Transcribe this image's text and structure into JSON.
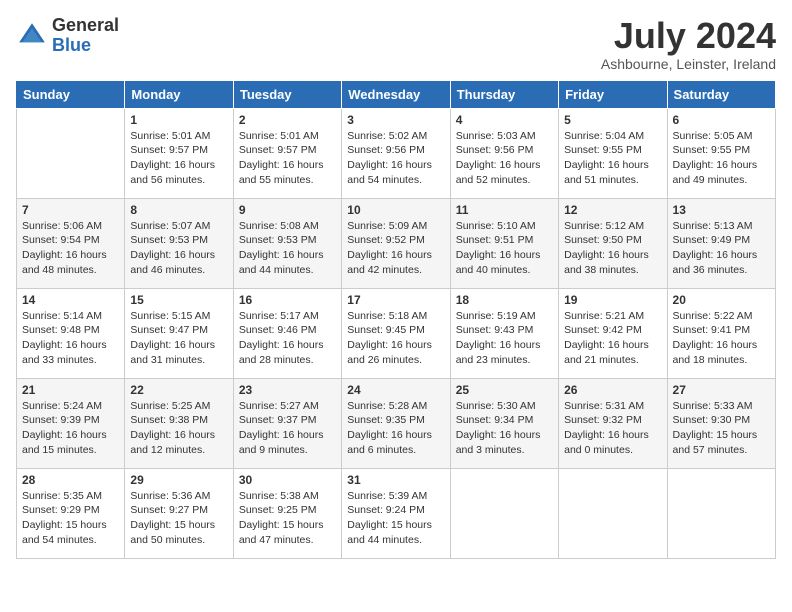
{
  "header": {
    "logo_general": "General",
    "logo_blue": "Blue",
    "month_year": "July 2024",
    "location": "Ashbourne, Leinster, Ireland"
  },
  "calendar": {
    "days_of_week": [
      "Sunday",
      "Monday",
      "Tuesday",
      "Wednesday",
      "Thursday",
      "Friday",
      "Saturday"
    ],
    "weeks": [
      [
        {
          "day": "",
          "sunrise": "",
          "sunset": "",
          "daylight": ""
        },
        {
          "day": "1",
          "sunrise": "Sunrise: 5:01 AM",
          "sunset": "Sunset: 9:57 PM",
          "daylight": "Daylight: 16 hours and 56 minutes."
        },
        {
          "day": "2",
          "sunrise": "Sunrise: 5:01 AM",
          "sunset": "Sunset: 9:57 PM",
          "daylight": "Daylight: 16 hours and 55 minutes."
        },
        {
          "day": "3",
          "sunrise": "Sunrise: 5:02 AM",
          "sunset": "Sunset: 9:56 PM",
          "daylight": "Daylight: 16 hours and 54 minutes."
        },
        {
          "day": "4",
          "sunrise": "Sunrise: 5:03 AM",
          "sunset": "Sunset: 9:56 PM",
          "daylight": "Daylight: 16 hours and 52 minutes."
        },
        {
          "day": "5",
          "sunrise": "Sunrise: 5:04 AM",
          "sunset": "Sunset: 9:55 PM",
          "daylight": "Daylight: 16 hours and 51 minutes."
        },
        {
          "day": "6",
          "sunrise": "Sunrise: 5:05 AM",
          "sunset": "Sunset: 9:55 PM",
          "daylight": "Daylight: 16 hours and 49 minutes."
        }
      ],
      [
        {
          "day": "7",
          "sunrise": "Sunrise: 5:06 AM",
          "sunset": "Sunset: 9:54 PM",
          "daylight": "Daylight: 16 hours and 48 minutes."
        },
        {
          "day": "8",
          "sunrise": "Sunrise: 5:07 AM",
          "sunset": "Sunset: 9:53 PM",
          "daylight": "Daylight: 16 hours and 46 minutes."
        },
        {
          "day": "9",
          "sunrise": "Sunrise: 5:08 AM",
          "sunset": "Sunset: 9:53 PM",
          "daylight": "Daylight: 16 hours and 44 minutes."
        },
        {
          "day": "10",
          "sunrise": "Sunrise: 5:09 AM",
          "sunset": "Sunset: 9:52 PM",
          "daylight": "Daylight: 16 hours and 42 minutes."
        },
        {
          "day": "11",
          "sunrise": "Sunrise: 5:10 AM",
          "sunset": "Sunset: 9:51 PM",
          "daylight": "Daylight: 16 hours and 40 minutes."
        },
        {
          "day": "12",
          "sunrise": "Sunrise: 5:12 AM",
          "sunset": "Sunset: 9:50 PM",
          "daylight": "Daylight: 16 hours and 38 minutes."
        },
        {
          "day": "13",
          "sunrise": "Sunrise: 5:13 AM",
          "sunset": "Sunset: 9:49 PM",
          "daylight": "Daylight: 16 hours and 36 minutes."
        }
      ],
      [
        {
          "day": "14",
          "sunrise": "Sunrise: 5:14 AM",
          "sunset": "Sunset: 9:48 PM",
          "daylight": "Daylight: 16 hours and 33 minutes."
        },
        {
          "day": "15",
          "sunrise": "Sunrise: 5:15 AM",
          "sunset": "Sunset: 9:47 PM",
          "daylight": "Daylight: 16 hours and 31 minutes."
        },
        {
          "day": "16",
          "sunrise": "Sunrise: 5:17 AM",
          "sunset": "Sunset: 9:46 PM",
          "daylight": "Daylight: 16 hours and 28 minutes."
        },
        {
          "day": "17",
          "sunrise": "Sunrise: 5:18 AM",
          "sunset": "Sunset: 9:45 PM",
          "daylight": "Daylight: 16 hours and 26 minutes."
        },
        {
          "day": "18",
          "sunrise": "Sunrise: 5:19 AM",
          "sunset": "Sunset: 9:43 PM",
          "daylight": "Daylight: 16 hours and 23 minutes."
        },
        {
          "day": "19",
          "sunrise": "Sunrise: 5:21 AM",
          "sunset": "Sunset: 9:42 PM",
          "daylight": "Daylight: 16 hours and 21 minutes."
        },
        {
          "day": "20",
          "sunrise": "Sunrise: 5:22 AM",
          "sunset": "Sunset: 9:41 PM",
          "daylight": "Daylight: 16 hours and 18 minutes."
        }
      ],
      [
        {
          "day": "21",
          "sunrise": "Sunrise: 5:24 AM",
          "sunset": "Sunset: 9:39 PM",
          "daylight": "Daylight: 16 hours and 15 minutes."
        },
        {
          "day": "22",
          "sunrise": "Sunrise: 5:25 AM",
          "sunset": "Sunset: 9:38 PM",
          "daylight": "Daylight: 16 hours and 12 minutes."
        },
        {
          "day": "23",
          "sunrise": "Sunrise: 5:27 AM",
          "sunset": "Sunset: 9:37 PM",
          "daylight": "Daylight: 16 hours and 9 minutes."
        },
        {
          "day": "24",
          "sunrise": "Sunrise: 5:28 AM",
          "sunset": "Sunset: 9:35 PM",
          "daylight": "Daylight: 16 hours and 6 minutes."
        },
        {
          "day": "25",
          "sunrise": "Sunrise: 5:30 AM",
          "sunset": "Sunset: 9:34 PM",
          "daylight": "Daylight: 16 hours and 3 minutes."
        },
        {
          "day": "26",
          "sunrise": "Sunrise: 5:31 AM",
          "sunset": "Sunset: 9:32 PM",
          "daylight": "Daylight: 16 hours and 0 minutes."
        },
        {
          "day": "27",
          "sunrise": "Sunrise: 5:33 AM",
          "sunset": "Sunset: 9:30 PM",
          "daylight": "Daylight: 15 hours and 57 minutes."
        }
      ],
      [
        {
          "day": "28",
          "sunrise": "Sunrise: 5:35 AM",
          "sunset": "Sunset: 9:29 PM",
          "daylight": "Daylight: 15 hours and 54 minutes."
        },
        {
          "day": "29",
          "sunrise": "Sunrise: 5:36 AM",
          "sunset": "Sunset: 9:27 PM",
          "daylight": "Daylight: 15 hours and 50 minutes."
        },
        {
          "day": "30",
          "sunrise": "Sunrise: 5:38 AM",
          "sunset": "Sunset: 9:25 PM",
          "daylight": "Daylight: 15 hours and 47 minutes."
        },
        {
          "day": "31",
          "sunrise": "Sunrise: 5:39 AM",
          "sunset": "Sunset: 9:24 PM",
          "daylight": "Daylight: 15 hours and 44 minutes."
        },
        {
          "day": "",
          "sunrise": "",
          "sunset": "",
          "daylight": ""
        },
        {
          "day": "",
          "sunrise": "",
          "sunset": "",
          "daylight": ""
        },
        {
          "day": "",
          "sunrise": "",
          "sunset": "",
          "daylight": ""
        }
      ]
    ]
  }
}
